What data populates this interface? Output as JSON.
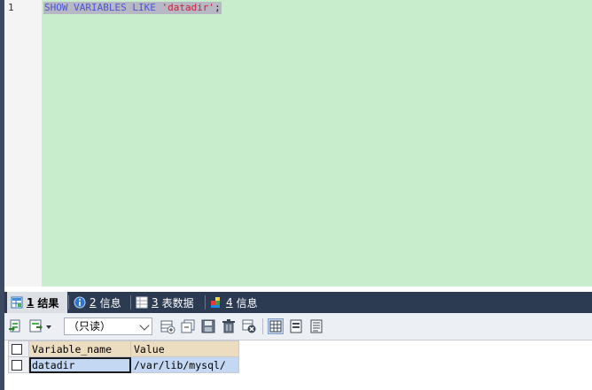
{
  "editor": {
    "line_number": "1",
    "code": {
      "kw1": "SHOW VARIABLES LIKE ",
      "str": "'datadir'",
      "punc": ";"
    }
  },
  "tabs": [
    {
      "num": "1",
      "label": "结果",
      "icon": "result-grid-icon",
      "active": true
    },
    {
      "num": "2",
      "label": "信息",
      "icon": "info-icon",
      "active": false
    },
    {
      "num": "3",
      "label": "表数据",
      "icon": "table-data-icon",
      "active": false
    },
    {
      "num": "4",
      "label": "信息",
      "icon": "puzzle-info-icon",
      "active": false
    }
  ],
  "toolbar": {
    "readonly_select": "（只读）"
  },
  "grid": {
    "columns": [
      "Variable_name",
      "Value"
    ],
    "rows": [
      [
        "datadir",
        "/var/lib/mysql/"
      ]
    ]
  },
  "colors": {
    "editor_bg": "#c7edcc",
    "tabbar_bg": "#2c3a52",
    "header_bg": "#ecdcc0",
    "cell_selected": "#c4d8f4"
  }
}
